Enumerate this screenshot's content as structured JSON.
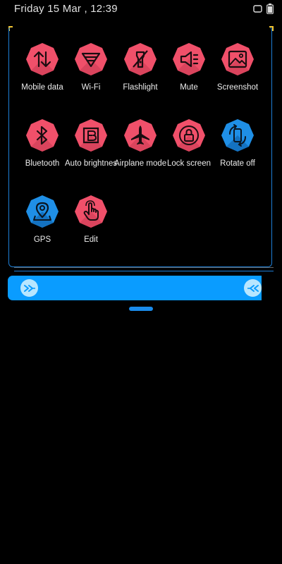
{
  "status": {
    "time_text": "Friday 15 Mar , 12:39"
  },
  "tiles": [
    {
      "label": "Mobile data",
      "icon": "mobile-data-icon",
      "color": "#f0506a"
    },
    {
      "label": "Wi-Fi",
      "icon": "wifi-icon",
      "color": "#f0506a"
    },
    {
      "label": "Flashlight",
      "icon": "flashlight-icon",
      "color": "#f0506a"
    },
    {
      "label": "Mute",
      "icon": "mute-icon",
      "color": "#f0506a"
    },
    {
      "label": "Screenshot",
      "icon": "screenshot-icon",
      "color": "#f0506a"
    },
    {
      "label": "Bluetooth",
      "icon": "bluetooth-icon",
      "color": "#f0506a"
    },
    {
      "label": "Auto brightness",
      "icon": "auto-brightness-icon",
      "color": "#f0506a"
    },
    {
      "label": "Airplane mode",
      "icon": "airplane-icon",
      "color": "#f0506a"
    },
    {
      "label": "Lock screen",
      "icon": "lock-icon",
      "color": "#f0506a"
    },
    {
      "label": "Rotate off",
      "icon": "rotate-icon",
      "color": "#1f8fe6"
    },
    {
      "label": "GPS",
      "icon": "gps-icon",
      "color": "#1f8fe6"
    },
    {
      "label": "Edit",
      "icon": "edit-icon",
      "color": "#f0506a"
    }
  ],
  "colors": {
    "accent_blue": "#0a9cff",
    "tile_red": "#f0506a",
    "tile_blue": "#1f8fe6"
  }
}
